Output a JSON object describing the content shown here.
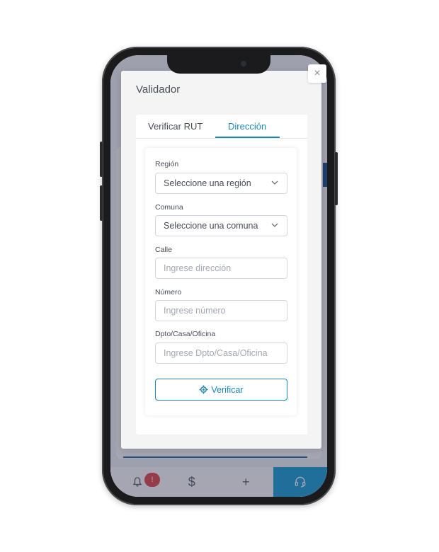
{
  "modal": {
    "title": "Validador",
    "close_symbol": "×",
    "tabs": [
      {
        "label": "Verificar RUT",
        "active": false
      },
      {
        "label": "Dirección",
        "active": true
      }
    ]
  },
  "form": {
    "region": {
      "label": "Región",
      "value": "Seleccione una región"
    },
    "comuna": {
      "label": "Comuna",
      "value": "Seleccione una comuna"
    },
    "calle": {
      "label": "Calle",
      "placeholder": "Ingrese dirección"
    },
    "numero": {
      "label": "Número",
      "placeholder": "Ingrese número"
    },
    "dpto": {
      "label": "Dpto/Casa/Oficina",
      "placeholder": "Ingrese Dpto/Casa/Oficina"
    },
    "verify_label": "Verificar"
  },
  "bottom_nav": {
    "badge": "!",
    "dollar": "$",
    "plus": "+"
  },
  "colors": {
    "accent": "#1b87b8",
    "badge": "#e5484d",
    "nav_active": "#1a9fd8"
  }
}
